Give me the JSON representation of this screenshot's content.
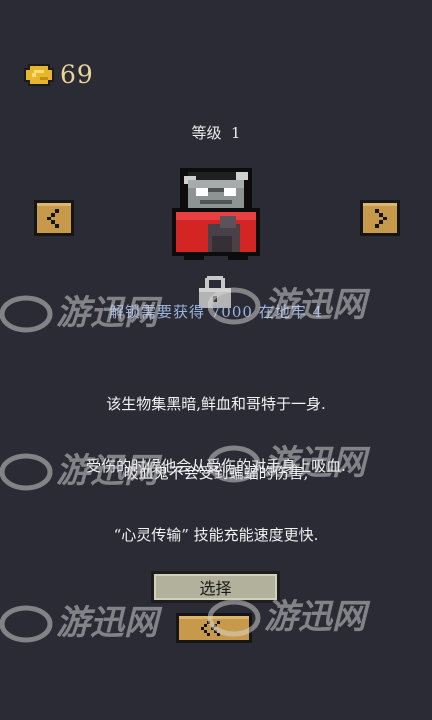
{
  "hud": {
    "coin_count": "69"
  },
  "character": {
    "level_label": "等级  1",
    "unlock_requirement": "解锁需要获得 7000 在地牢 4",
    "description_line_1": "该生物集黑暗,鲜血和哥特于一身.",
    "description_line_2": "吸血鬼不会受到蝙蝠的伤害,",
    "ability_line_1": "受伤的时候他会从受伤的对手身上吸血.",
    "ability_line_2": "“心灵传输” 技能充能速度更快."
  },
  "buttons": {
    "select_label": "选择"
  },
  "watermark": {
    "text": "游迅网"
  },
  "colors": {
    "background": "#2b2b35",
    "coin_gold": "#e8b62a",
    "unlock_text": "#9cb4dc",
    "button_fill": "#b2b29c",
    "nav_button_fill": "#c69a4a"
  },
  "icons": {
    "coin": "coin-icon",
    "prev": "chevron-left-icon",
    "next": "chevron-right-icon",
    "lock": "lock-icon",
    "back": "double-chevron-left-icon"
  }
}
